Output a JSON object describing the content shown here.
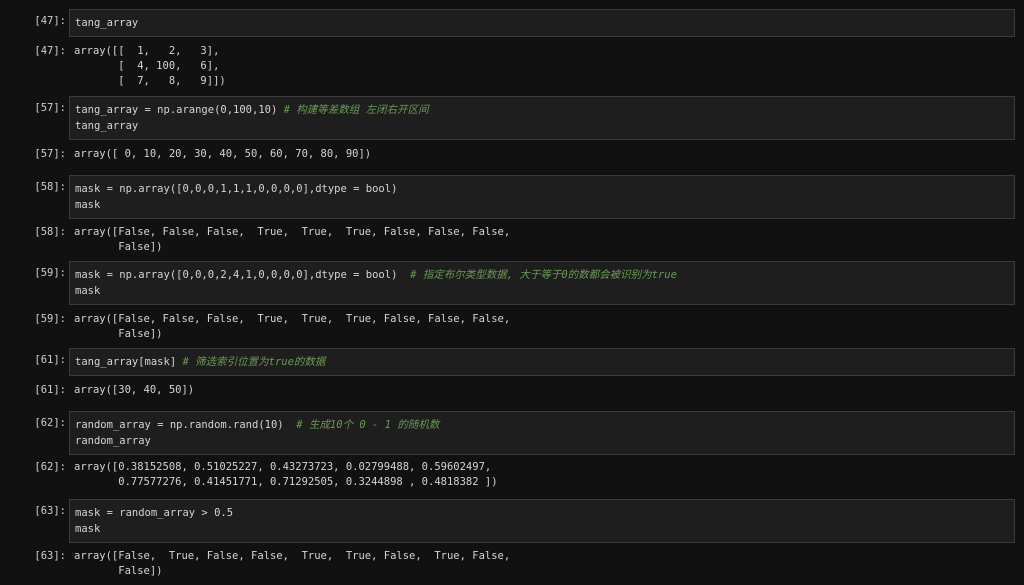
{
  "cells": [
    {
      "prompt_in": "[47]:",
      "code": "tang_array",
      "prompt_out": "[47]:",
      "output": "array([[  1,   2,   3],\n       [  4, 100,   6],\n       [  7,   8,   9]])"
    },
    {
      "prompt_in": "[57]:",
      "code_line1": "tang_array = np.arange(0,100,10)",
      "comment": "# 构建等差数组 左闭右开区间",
      "code_line2": "tang_array",
      "prompt_out": "[57]:",
      "output": "array([ 0, 10, 20, 30, 40, 50, 60, 70, 80, 90])"
    },
    {
      "prompt_in": "[58]:",
      "code_line1": "mask = np.array([0,0,0,1,1,1,0,0,0,0],dtype = bool)",
      "code_line2": "mask",
      "prompt_out": "[58]:",
      "output": "array([False, False, False,  True,  True,  True, False, False, False,\n       False])"
    },
    {
      "prompt_in": "[59]:",
      "code_line1": "mask = np.array([0,0,0,2,4,1,0,0,0,0],dtype = bool)",
      "comment": "# 指定布尔类型数据, 大于等于0的数都会被识别为true",
      "code_line2": "mask",
      "prompt_out": "[59]:",
      "output": "array([False, False, False,  True,  True,  True, False, False, False,\n       False])"
    },
    {
      "prompt_in": "[61]:",
      "code_line1": "tang_array[mask]",
      "comment": "# 筛选索引位置为true的数据",
      "prompt_out": "[61]:",
      "output": "array([30, 40, 50])"
    },
    {
      "prompt_in": "[62]:",
      "code_line1": "random_array = np.random.rand(10)",
      "comment": "# 生成10个 0 - 1 的随机数",
      "code_line2": "random_array",
      "prompt_out": "[62]:",
      "output": "array([0.38152508, 0.51025227, 0.43273723, 0.02799488, 0.59602497,\n       0.77577276, 0.41451771, 0.71292505, 0.3244898 , 0.4818382 ])"
    },
    {
      "prompt_in": "[63]:",
      "code_line1": "mask = random_array > 0.5",
      "code_line2": "mask",
      "prompt_out": "[63]:",
      "output": "array([False,  True, False, False,  True,  True, False,  True, False,\n       False])"
    }
  ]
}
